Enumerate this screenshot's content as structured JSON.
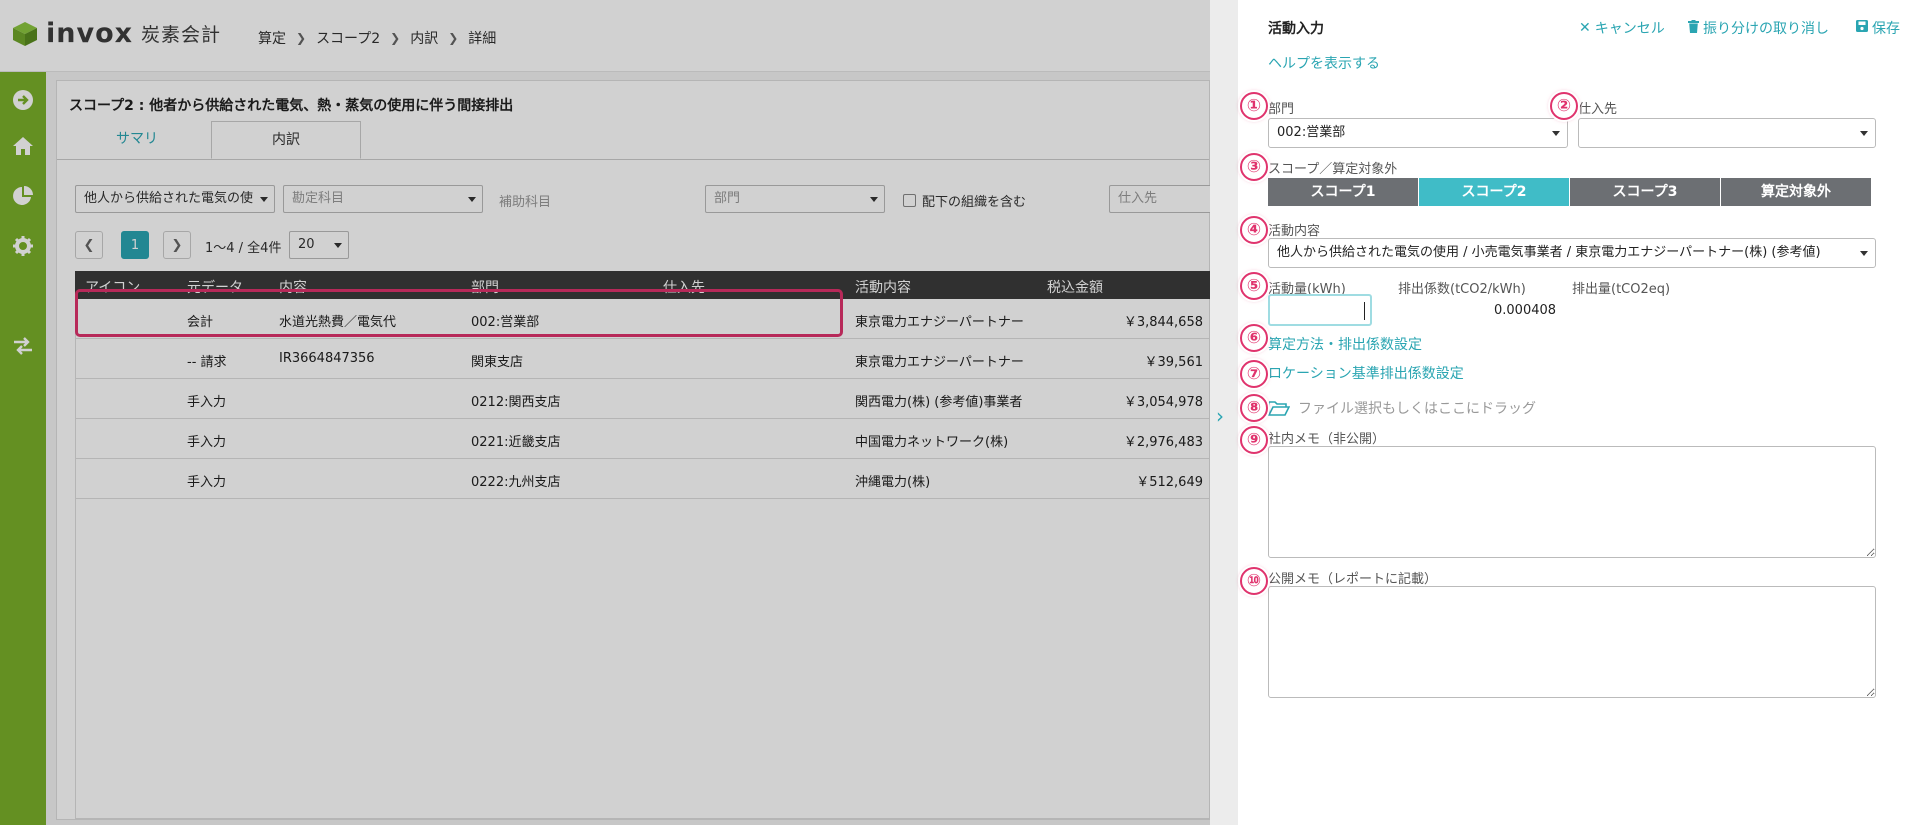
{
  "app": {
    "brand": "invox",
    "brand_sub": "炭素会計",
    "breadcrumb": [
      "算定",
      "スコープ2",
      "内訳",
      "詳細"
    ],
    "colors": {
      "sidebar": "#7bb02a",
      "accent": "#2aa5b2",
      "highlight": "#e0336d"
    }
  },
  "sidebar": {
    "icons": [
      "arrow-right-circle-icon",
      "home-icon",
      "pie-chart-icon",
      "gear-icon",
      "swap-arrows-icon"
    ]
  },
  "panel": {
    "title": "スコープ2 : 他者から供給された電気、熱・蒸気の使用に伴う間接排出",
    "tabs": [
      "サマリ",
      "内訳"
    ],
    "active_tab": "内訳",
    "filters": {
      "activity": "他人から供給された電気の使",
      "account": "勘定科目",
      "sub_account_label": "補助科目",
      "department": "部門",
      "include_children": "配下の組織を含む",
      "supplier": "仕入先"
    },
    "pagination": {
      "current": "1",
      "range": "1〜4 / 全4件",
      "page_size": "20"
    },
    "columns": [
      "アイコン",
      "元データ",
      "内容",
      "部門",
      "仕入先",
      "活動内容",
      "税込金額"
    ],
    "rows": [
      {
        "source": "会計",
        "content": "水道光熱費／電気代",
        "dept": "002:営業部",
        "supplier": "",
        "activity": "東京電力エナジーパートナー",
        "amount": "￥3,844,658"
      },
      {
        "source": "-- 請求",
        "content": "IR3664847356",
        "dept": "関東支店",
        "supplier": "",
        "activity": "東京電力エナジーパートナー",
        "amount": "￥39,561"
      },
      {
        "source": "手入力",
        "content": "",
        "dept": "0212:関西支店",
        "supplier": "",
        "activity": "関西電力(株) (参考値)事業者",
        "amount": "￥3,054,978"
      },
      {
        "source": "手入力",
        "content": "",
        "dept": "0221:近畿支店",
        "supplier": "",
        "activity": "中国電力ネットワーク(株)",
        "amount": "￥2,976,483"
      },
      {
        "source": "手入力",
        "content": "",
        "dept": "0222:九州支店",
        "supplier": "",
        "activity": "沖縄電力(株)",
        "amount": "￥512,649"
      }
    ]
  },
  "drawer": {
    "title": "活動入力",
    "cancel": "キャンセル",
    "undo_allocation": "振り分けの取り消し",
    "save": "保存",
    "help": "ヘルプを表示する",
    "badges": [
      "①",
      "②",
      "③",
      "④",
      "⑤",
      "⑥",
      "⑦",
      "⑧",
      "⑨",
      "⑩"
    ],
    "department_label": "部門",
    "department_value": "002:営業部",
    "supplier_label": "仕入先",
    "supplier_value": "",
    "scope_label": "スコープ／算定対象外",
    "scope_buttons": [
      "スコープ1",
      "スコープ2",
      "スコープ3",
      "算定対象外"
    ],
    "scope_selected": "スコープ2",
    "activity_label": "活動内容",
    "activity_value": "他人から供給された電気の使用 / 小売電気事業者 / 東京電力エナジーパートナー(株) (参考値)",
    "amount_label": "活動量(kWh)",
    "amount_value": "",
    "factor_label": "排出係数(tCO2/kWh)",
    "factor_value": "0.000408",
    "emission_label": "排出量(tCO2eq)",
    "method_link": "算定方法・排出係数設定",
    "location_link": "ロケーション基準排出係数設定",
    "file_drop": "ファイル選択もしくはここにドラッグ",
    "internal_memo_label": "社内メモ（非公開）",
    "public_memo_label": "公開メモ（レポートに記載）"
  }
}
